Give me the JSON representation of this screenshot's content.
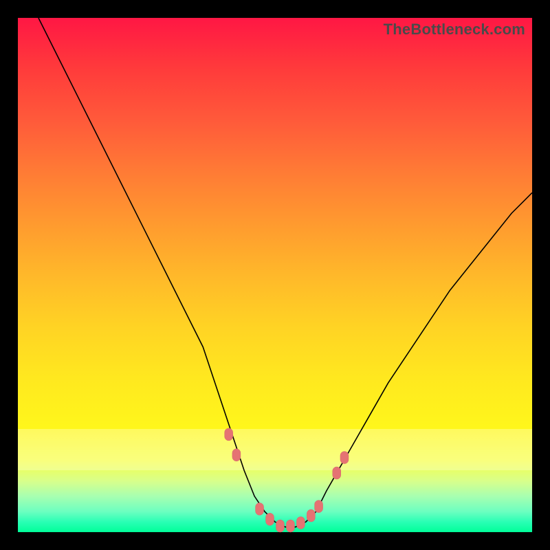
{
  "watermark": "TheBottleneck.com",
  "chart_data": {
    "type": "line",
    "title": "",
    "xlabel": "",
    "ylabel": "",
    "xlim": [
      0,
      100
    ],
    "ylim": [
      0,
      100
    ],
    "grid": false,
    "legend": false,
    "series": [
      {
        "name": "bottleneck-curve",
        "x": [
          4,
          8,
          12,
          16,
          20,
          24,
          28,
          32,
          36,
          38,
          40,
          42,
          44,
          46,
          48,
          50,
          52,
          54,
          56,
          58,
          60,
          64,
          68,
          72,
          76,
          80,
          84,
          88,
          92,
          96,
          100
        ],
        "y": [
          100,
          92,
          84,
          76,
          68,
          60,
          52,
          44,
          36,
          30,
          24,
          18,
          12,
          7,
          4,
          2,
          1,
          1,
          2,
          4,
          8,
          15,
          22,
          29,
          35,
          41,
          47,
          52,
          57,
          62,
          66
        ]
      }
    ],
    "markers": {
      "name": "highlight-points",
      "x": [
        41,
        42.5,
        47,
        49,
        51,
        53,
        55,
        57,
        58.5,
        62,
        63.5
      ],
      "y": [
        19,
        15,
        4.5,
        2.5,
        1.2,
        1.2,
        1.8,
        3.2,
        5,
        11.5,
        14.5
      ]
    },
    "background_gradient": {
      "top_color": "#ff1744",
      "mid_color": "#ffe81f",
      "bottom_color": "#00ff99"
    },
    "pale_band_y_range": [
      12,
      20
    ]
  }
}
